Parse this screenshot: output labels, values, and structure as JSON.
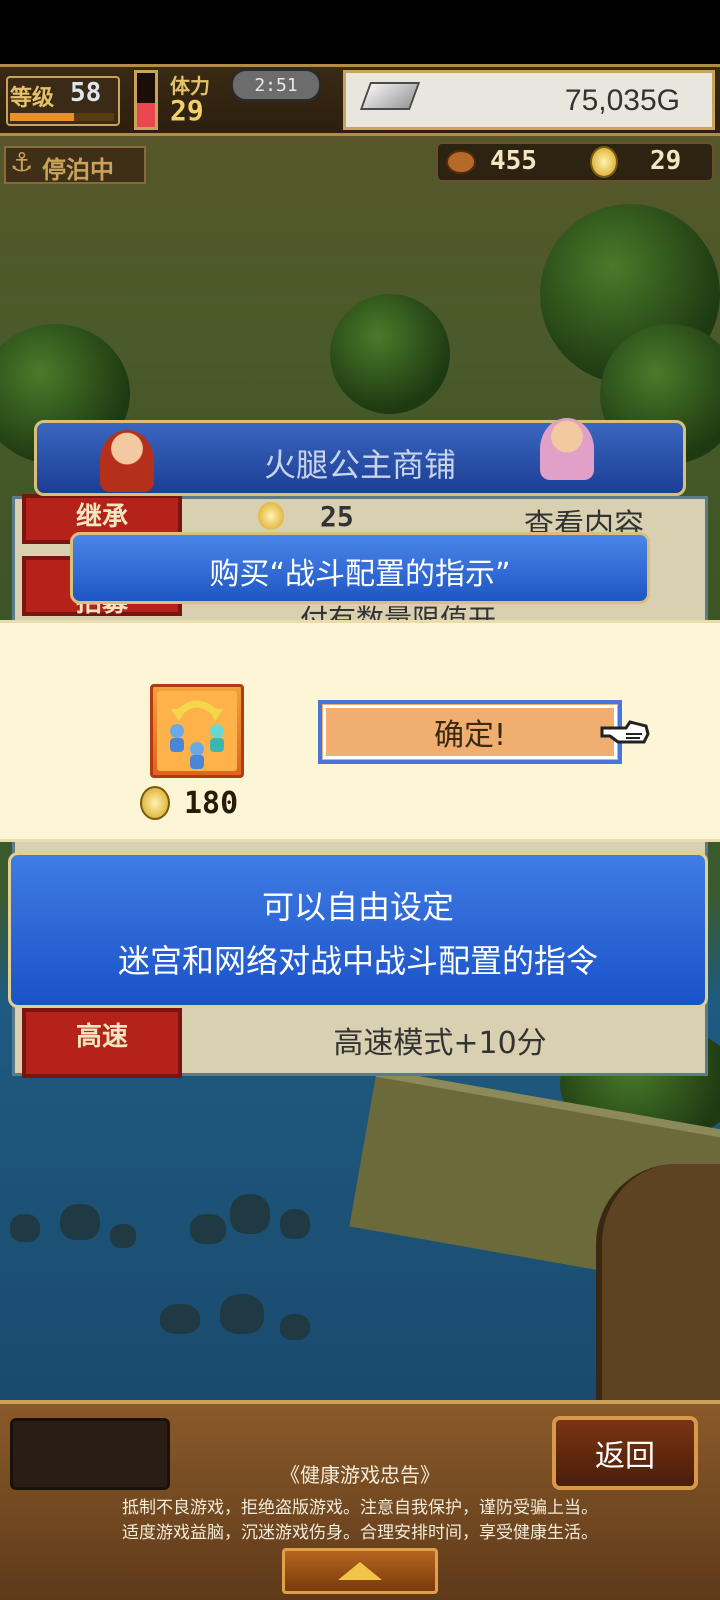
{
  "hud": {
    "level_label": "等级",
    "level_value": "58",
    "level_progress": 0.62,
    "stamina_label": "体力",
    "stamina_value": "29",
    "stamina_fill": 0.45,
    "time": "2:51",
    "money": "75,035G",
    "status_label": "停泊中",
    "meat_value": "455",
    "coin_value": "29"
  },
  "shop": {
    "title": "火腿公主商铺",
    "row1_tag": "继承",
    "row1_price": "25",
    "row1_action": "查看内容",
    "row2_tag": "招募",
    "row2_text": "付有数量限值开",
    "last_tag": "高速",
    "last_text": "高速模式+10分"
  },
  "purchase": {
    "title": "购买“战斗配置的指示”",
    "cost": "180",
    "confirm_label": "确定!",
    "description_line1": "可以自由设定",
    "description_line2": "迷宫和网络对战中战斗配置的指令"
  },
  "bottom": {
    "back_label": "返回",
    "notice_title": "《健康游戏忠告》",
    "notice_line1": "抵制不良游戏，拒绝盗版游戏。注意自我保护，谨防受骗上当。",
    "notice_line2": "适度游戏益脑，沉迷游戏伤身。合理安排时间，享受健康生活。"
  },
  "icons": {
    "stamina": "stamina-gauge-icon",
    "money": "silver-bar-icon",
    "status": "anchor-icon",
    "meat": "meat-icon",
    "coin": "gold-coin-icon",
    "item": "party-formation-icon",
    "pointer": "pointing-hand-icon",
    "up": "up-arrow-icon"
  },
  "colors": {
    "panel_blue": "#1e56c4",
    "confirm_bg": "#fdf6d6",
    "confirm_button": "#f0ae70",
    "gold_border": "#c9a359"
  }
}
